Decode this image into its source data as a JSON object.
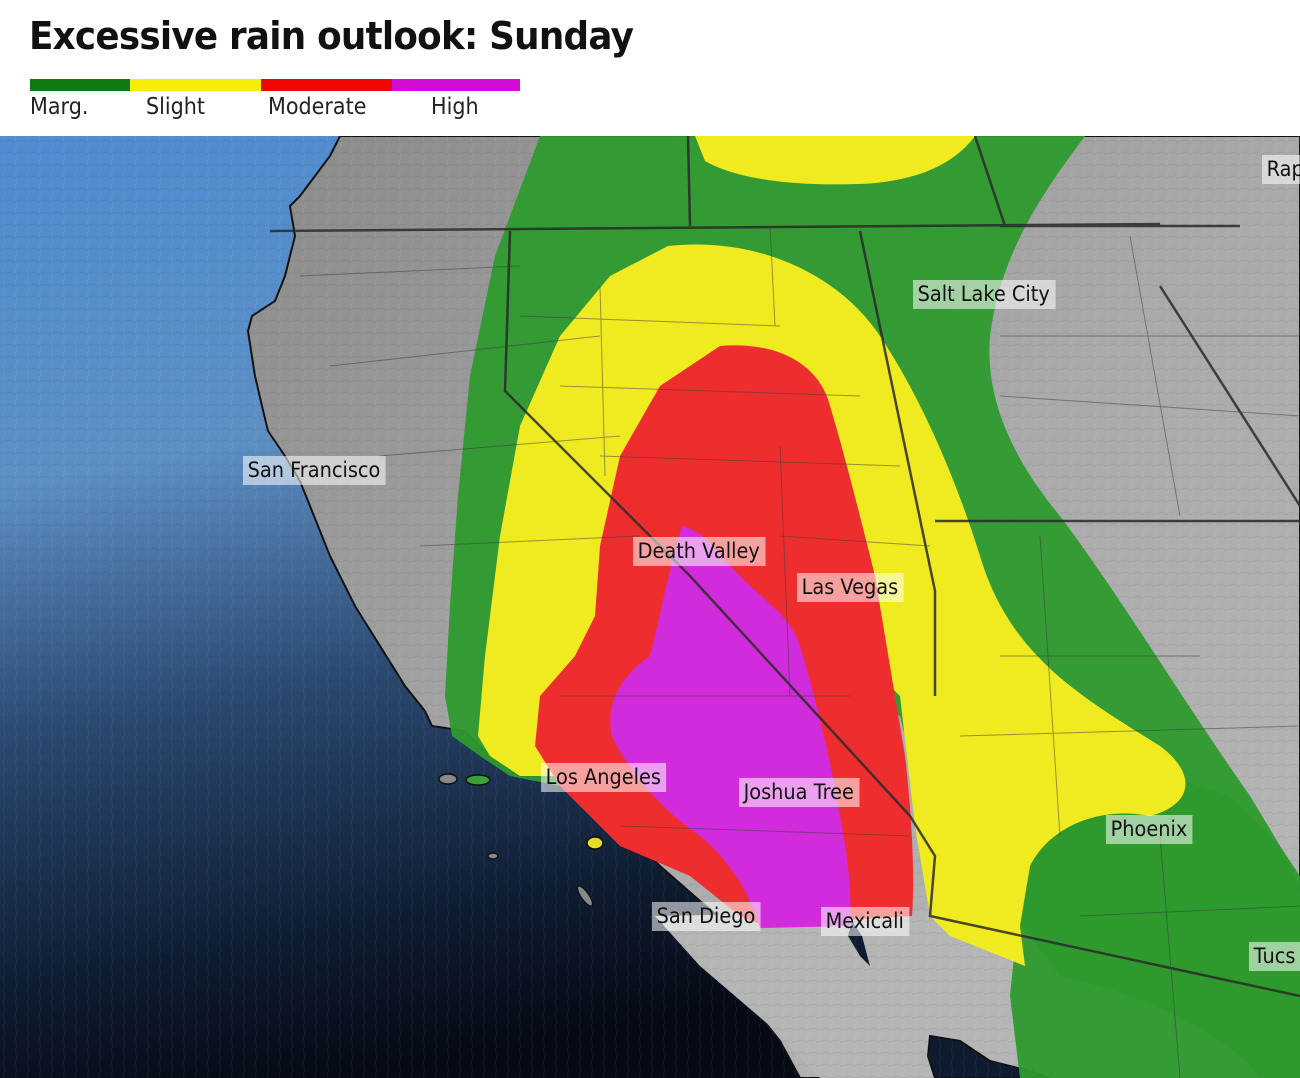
{
  "title": "Excessive rain outlook: Sunday",
  "legend": [
    {
      "label": "Marg.",
      "color": "#0e7a12"
    },
    {
      "label": "Slight",
      "color": "#f5ee08"
    },
    {
      "label": "Moderate",
      "color": "#f00505"
    },
    {
      "label": "High",
      "color": "#d40ad6"
    }
  ],
  "zone_colors": {
    "marginal": "#2e9a2e",
    "slight": "#f0ea20",
    "moderate": "#ee2e2e",
    "high": "#d22bdc"
  },
  "cities": [
    {
      "name": "Rap",
      "key": "rapid-city"
    },
    {
      "name": "Salt Lake City",
      "key": "salt-lake-city"
    },
    {
      "name": "San Francisco",
      "key": "san-francisco"
    },
    {
      "name": "Death Valley",
      "key": "death-valley"
    },
    {
      "name": "Las Vegas",
      "key": "las-vegas"
    },
    {
      "name": "Los Angeles",
      "key": "los-angeles"
    },
    {
      "name": "Joshua Tree",
      "key": "joshua-tree"
    },
    {
      "name": "Phoenix",
      "key": "phoenix"
    },
    {
      "name": "San Diego",
      "key": "san-diego"
    },
    {
      "name": "Mexicali",
      "key": "mexicali"
    },
    {
      "name": "Tucs",
      "key": "tucson"
    }
  ]
}
